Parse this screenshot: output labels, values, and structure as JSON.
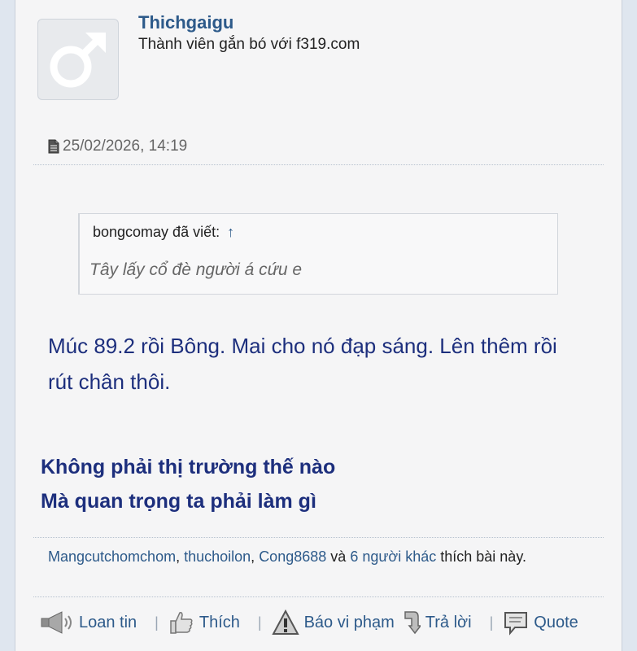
{
  "user": {
    "name": "Thichgaigu",
    "title": "Thành viên gắn bó với f319.com",
    "avatar_icon": "male-symbol-icon"
  },
  "post": {
    "date": "25/02/2026, 14:19",
    "quote": {
      "author_line": "bongcomay đã viết:",
      "arrow": "↑",
      "text": "Tây lấy cổ đè người á cứu e"
    },
    "message": "Múc 89.2 rồi Bông. Mai cho nó đạp sáng. Lên thêm rồi rút chân thôi.",
    "signature": [
      "Không phải thị trường thế nào",
      "Mà quan trọng ta phải làm gì"
    ]
  },
  "likes": {
    "users": [
      "Mangcutchomchom",
      "thuchoilon",
      "Cong8688"
    ],
    "connector": "và",
    "others": "6 người khác",
    "suffix": "thích bài này."
  },
  "actions": {
    "report_ad": "Loan tin",
    "like": "Thích",
    "report": "Báo vi phạm",
    "reply": "Trả lời",
    "quote": "Quote",
    "separator": "|"
  },
  "colors": {
    "link": "#2d5a8a",
    "message": "#1d2f7d",
    "panel": "#f5f5f6",
    "page": "#dfe6ef"
  }
}
